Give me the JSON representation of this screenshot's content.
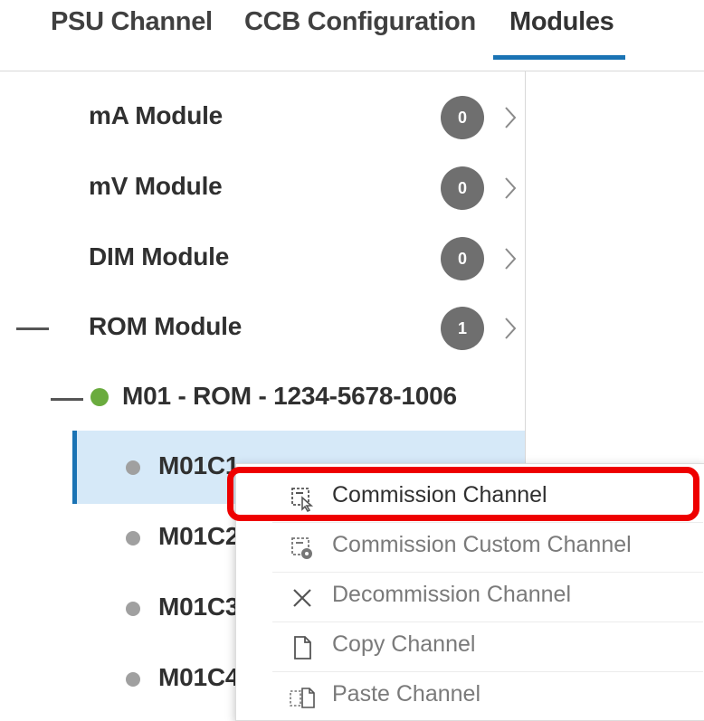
{
  "tabs": [
    {
      "label": "PSU Channel"
    },
    {
      "label": "CCB Configuration"
    },
    {
      "label": "Modules",
      "active": true
    }
  ],
  "modules": [
    {
      "label": "mA Module",
      "count": "0",
      "icon": "chevron-right-icon"
    },
    {
      "label": "mV Module",
      "count": "0",
      "icon": "chevron-right-icon"
    },
    {
      "label": "DIM Module",
      "count": "0",
      "icon": "chevron-right-icon"
    },
    {
      "label": "ROM Module",
      "count": "1",
      "expanded": true,
      "icon": "chevron-right-icon"
    }
  ],
  "device": {
    "label": "M01 - ROM - 1234-5678-1006",
    "status_color": "#6aab3e"
  },
  "channels": [
    {
      "label": "M01C1",
      "selected": true
    },
    {
      "label": "M01C2"
    },
    {
      "label": "M01C3"
    },
    {
      "label": "M01C4"
    }
  ],
  "context_menu": {
    "items": [
      {
        "label": "Commission Channel",
        "icon": "commission-icon",
        "enabled": true,
        "highlighted": true
      },
      {
        "label": "Commission Custom Channel",
        "icon": "commission-custom-icon",
        "enabled": false
      },
      {
        "label": "Decommission Channel",
        "icon": "close-icon",
        "enabled": false
      },
      {
        "label": "Copy Channel",
        "icon": "document-icon",
        "enabled": false
      },
      {
        "label": "Paste Channel",
        "icon": "paste-icon",
        "enabled": false
      }
    ]
  },
  "colors": {
    "accent": "#1a73b4",
    "selected_row_bg": "#d6e9f8",
    "badge_bg": "#6f6f6f",
    "highlight_border": "#ee0000",
    "device_status": "#6aab3e",
    "channel_dot": "#a0a0a0",
    "text_enabled": "#303030",
    "text_disabled": "#7a7a7a"
  }
}
